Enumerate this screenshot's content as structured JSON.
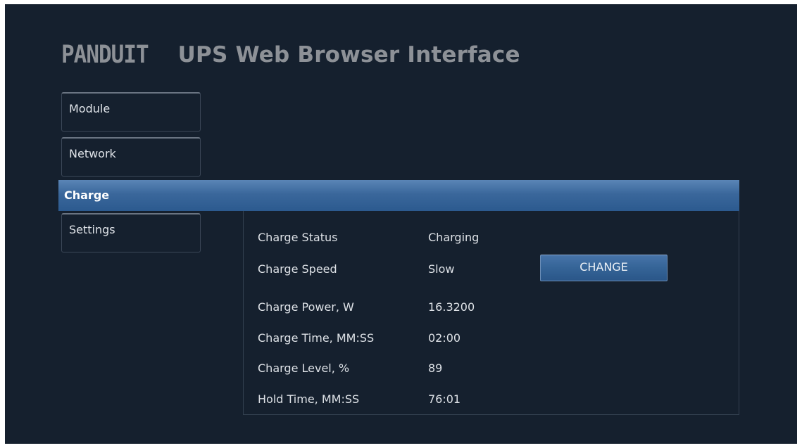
{
  "header": {
    "logo_text": "PANDUIT",
    "title": "UPS Web Browser Interface"
  },
  "nav": {
    "module": "Module",
    "network": "Network",
    "charge": "Charge",
    "settings": "Settings",
    "active": "Charge"
  },
  "charge": {
    "rows": [
      {
        "label": "Charge Status",
        "value": "Charging"
      },
      {
        "label": "Charge Speed",
        "value": "Slow"
      },
      {
        "label": "Charge Power, W",
        "value": "16.3200"
      },
      {
        "label": "Charge Time, MM:SS",
        "value": "02:00"
      },
      {
        "label": "Charge Level, %",
        "value": "89"
      },
      {
        "label": "Hold Time, MM:SS",
        "value": "76:01"
      }
    ],
    "change_button": "CHANGE"
  },
  "colors": {
    "background": "#15202e",
    "active_tab": "#3a679b",
    "header_text": "#8d9197",
    "text": "#dde1e6"
  }
}
